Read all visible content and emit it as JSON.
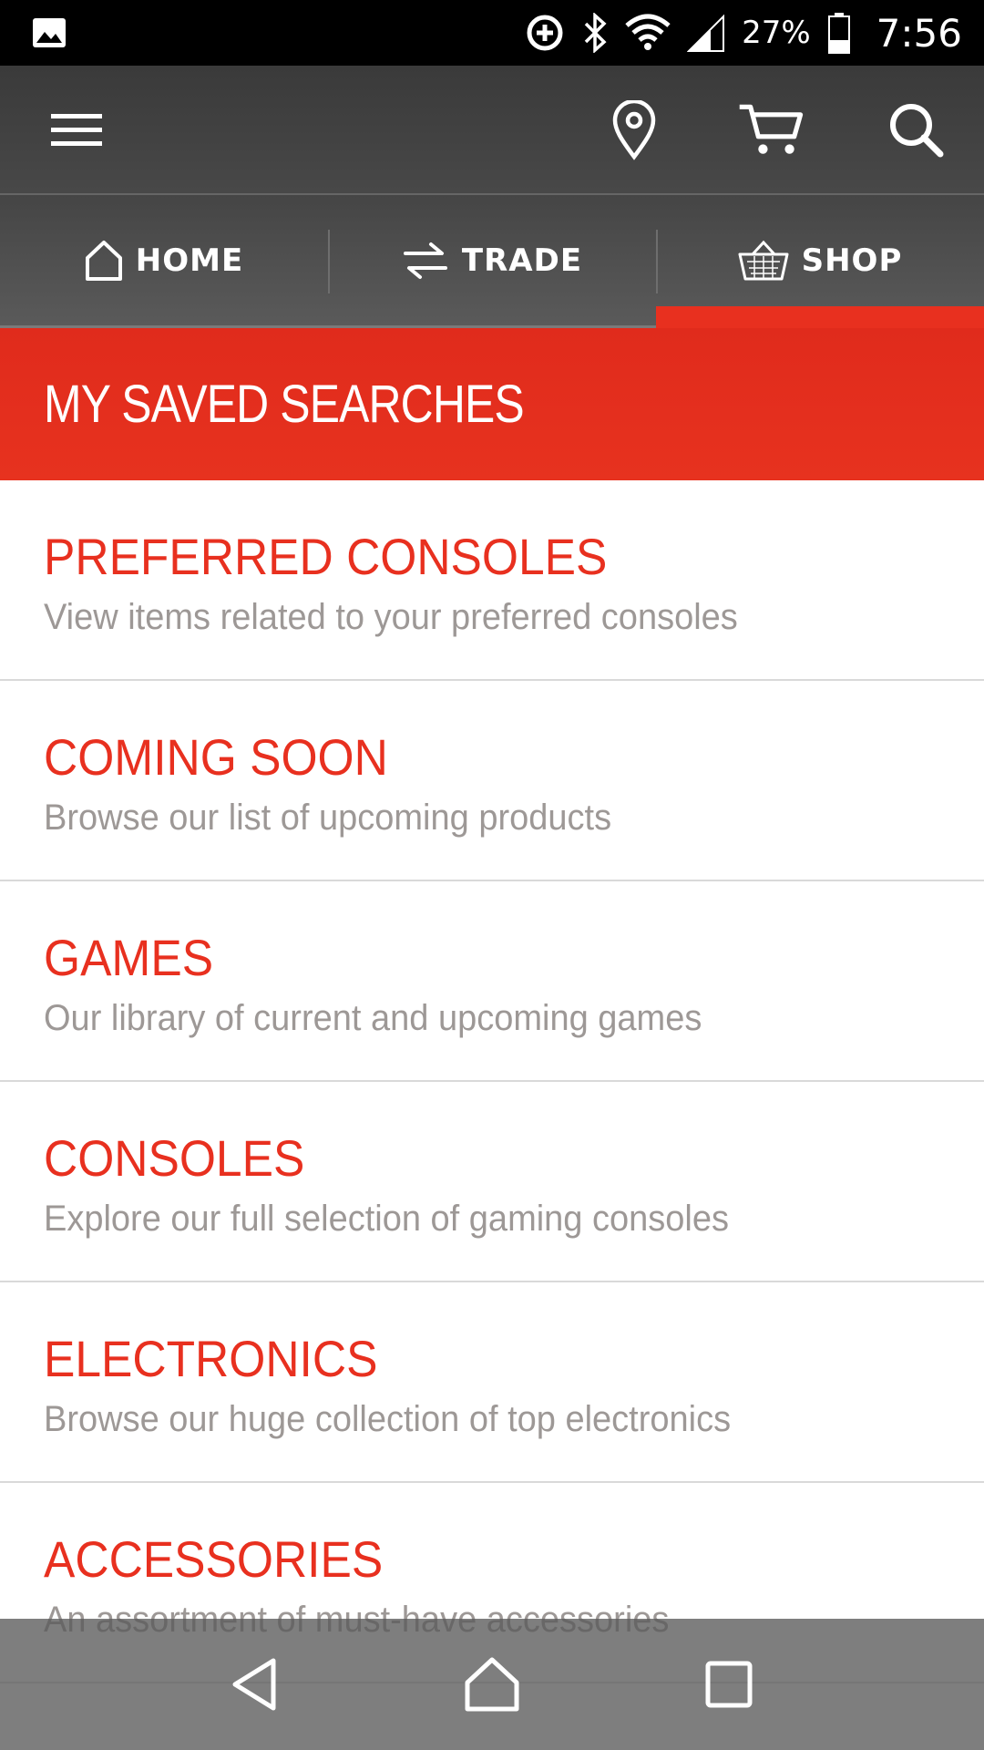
{
  "status_bar": {
    "battery_percent": "27%",
    "time": "7:56",
    "icons": [
      "gallery-icon",
      "data-saver-icon",
      "bluetooth-icon",
      "wifi-icon",
      "signal-icon",
      "battery-icon"
    ]
  },
  "top_bar": {
    "icons": [
      "menu-icon",
      "location-pin-icon",
      "cart-icon",
      "search-icon"
    ]
  },
  "tabs": [
    {
      "label": "HOME",
      "icon": "home-icon",
      "active": false
    },
    {
      "label": "TRADE",
      "icon": "trade-arrows-icon",
      "active": false
    },
    {
      "label": "SHOP",
      "icon": "basket-icon",
      "active": true
    }
  ],
  "banner": {
    "title": "MY SAVED SEARCHES"
  },
  "list": [
    {
      "title": "PREFERRED CONSOLES",
      "desc": "View items related to your preferred consoles"
    },
    {
      "title": "COMING SOON",
      "desc": "Browse our list of upcoming products"
    },
    {
      "title": "GAMES",
      "desc": "Our library of current and upcoming games"
    },
    {
      "title": "CONSOLES",
      "desc": "Explore our full selection of gaming consoles"
    },
    {
      "title": "ELECTRONICS",
      "desc": "Browse our huge collection of top electronics"
    },
    {
      "title": "ACCESSORIES",
      "desc": "An assortment of must-have accessories"
    }
  ],
  "nav_bar": {
    "icons": [
      "back-icon",
      "home-nav-icon",
      "recents-icon"
    ]
  },
  "colors": {
    "accent": "#e8301f",
    "description_text": "#9d9896",
    "top_bar": "#3a3a3a"
  }
}
